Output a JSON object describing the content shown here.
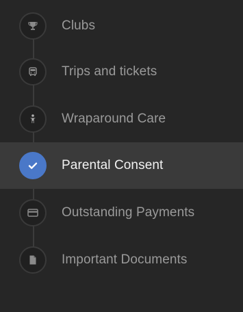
{
  "nav": {
    "items": [
      {
        "label": "Clubs",
        "icon": "trophy-icon",
        "active": false
      },
      {
        "label": "Trips and tickets",
        "icon": "bus-icon",
        "active": false
      },
      {
        "label": "Wraparound Care",
        "icon": "child-icon",
        "active": false
      },
      {
        "label": "Parental Consent",
        "icon": "checkmark-icon",
        "active": true
      },
      {
        "label": "Outstanding Payments",
        "icon": "credit-card-icon",
        "active": false
      },
      {
        "label": "Important Documents",
        "icon": "document-icon",
        "active": false
      }
    ],
    "colors": {
      "background": "#262626",
      "active_background": "#3a3a3a",
      "accent": "#4a78c8",
      "label": "#9a9a9a",
      "active_label": "#f2f2f2"
    }
  }
}
